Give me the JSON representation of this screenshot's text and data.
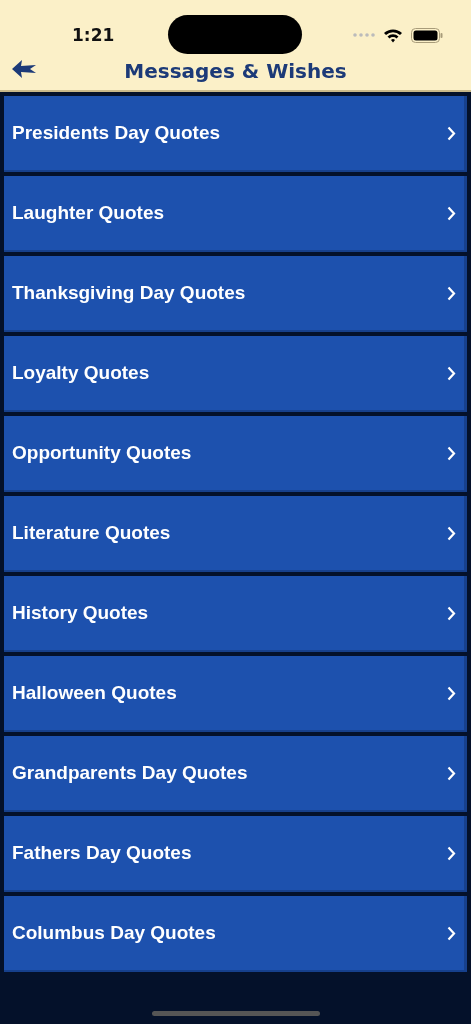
{
  "status_bar": {
    "time": "1:21"
  },
  "nav": {
    "title": "Messages & Wishes"
  },
  "items": [
    {
      "label": "Presidents Day Quotes"
    },
    {
      "label": "Laughter Quotes"
    },
    {
      "label": "Thanksgiving Day Quotes"
    },
    {
      "label": "Loyalty Quotes"
    },
    {
      "label": "Opportunity Quotes"
    },
    {
      "label": "Literature Quotes"
    },
    {
      "label": "History Quotes"
    },
    {
      "label": "Halloween Quotes"
    },
    {
      "label": "Grandparents Day Quotes"
    },
    {
      "label": "Fathers Day Quotes"
    },
    {
      "label": "Columbus Day Quotes"
    }
  ]
}
